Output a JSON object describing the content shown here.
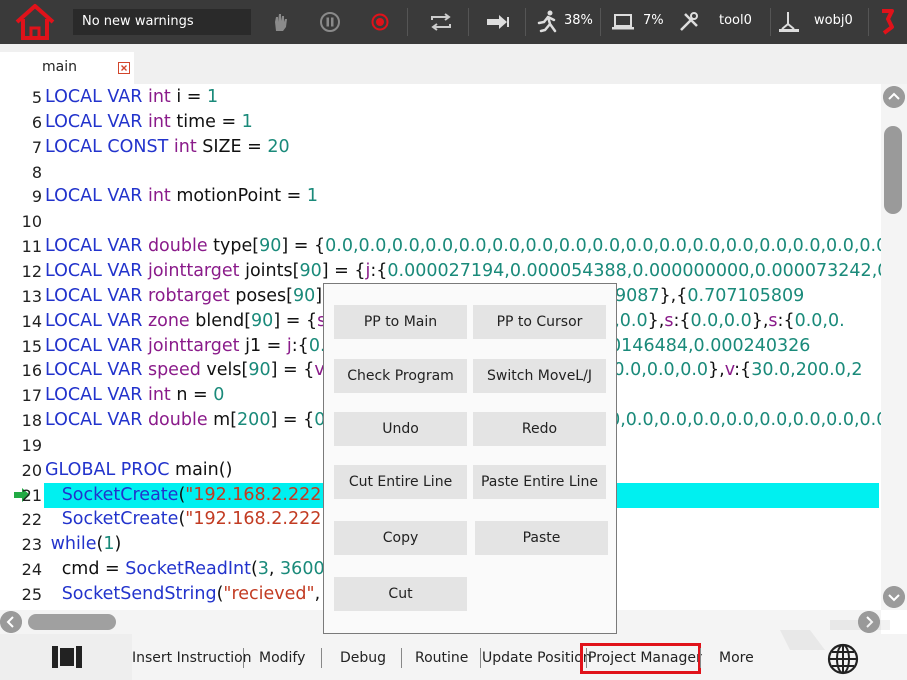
{
  "topbar": {
    "warnings_text": "No new warnings",
    "speed_value": "38%",
    "load_value": "7%",
    "tool_name": "tool0",
    "wobj_name": "wobj0",
    "icons": [
      "home-icon",
      "hand-icon",
      "pause-icon",
      "record-icon",
      "loop-icon",
      "step-forward-icon",
      "speed-icon",
      "laptop-icon",
      "tool-icon",
      "wobj-icon",
      "robot-arm-icon"
    ],
    "accent_color": "#e0121a"
  },
  "tabs": [
    {
      "label": "main"
    }
  ],
  "code_lines": [
    {
      "num": "5",
      "tokens": [
        [
          "LOCAL VAR ",
          "kw"
        ],
        [
          "int",
          "ty"
        ],
        [
          " i = ",
          ""
        ],
        [
          "1",
          "nm"
        ]
      ]
    },
    {
      "num": "6",
      "tokens": [
        [
          "LOCAL VAR ",
          "kw"
        ],
        [
          "int",
          "ty"
        ],
        [
          " time = ",
          ""
        ],
        [
          "1",
          "nm"
        ]
      ]
    },
    {
      "num": "7",
      "tokens": [
        [
          "LOCAL CONST ",
          "kw"
        ],
        [
          "int",
          "ty"
        ],
        [
          " SIZE = ",
          ""
        ],
        [
          "20",
          "nm"
        ]
      ]
    },
    {
      "num": "8",
      "tokens": []
    },
    {
      "num": "9",
      "tokens": [
        [
          "LOCAL VAR ",
          "kw"
        ],
        [
          "int",
          "ty"
        ],
        [
          " motionPoint = ",
          ""
        ],
        [
          "1",
          "nm"
        ]
      ]
    },
    {
      "num": "10",
      "tokens": []
    },
    {
      "num": "11",
      "tokens": [
        [
          "LOCAL VAR ",
          "kw"
        ],
        [
          "double",
          "ty"
        ],
        [
          " type[",
          ""
        ],
        [
          "90",
          "nm"
        ],
        [
          "] = {",
          ""
        ],
        [
          "0.0,0.0,0.0,0.0,0.0,0.0,0.0,0.0,0.0,0.0,0.0,0.0,0.0,0.0,0.0,0.0,0.0,0.0,0.0",
          "nm"
        ]
      ]
    },
    {
      "num": "12",
      "tokens": [
        [
          "LOCAL VAR ",
          "kw"
        ],
        [
          "jointtarget",
          "ty"
        ],
        [
          " joints[",
          ""
        ],
        [
          "90",
          "nm"
        ],
        [
          "] = {",
          ""
        ],
        [
          "j",
          "ty"
        ],
        [
          ":{",
          ""
        ],
        [
          "0.000027194,0.000054388,0.000000000,0.000073242,0.0001",
          "nm"
        ]
      ]
    },
    {
      "num": "13",
      "tokens": [
        [
          "LOCAL VAR ",
          "kw"
        ],
        [
          "robtarget",
          "ty"
        ],
        [
          " poses[",
          ""
        ],
        [
          "90",
          "nm"
        ],
        [
          "] = ",
          ""
        ],
        [
          "                              ",
          ""
        ],
        [
          ",854.999359087",
          "nm"
        ],
        [
          "},{",
          ""
        ],
        [
          "0.707105809",
          "nm"
        ]
      ]
    },
    {
      "num": "14",
      "tokens": [
        [
          "LOCAL VAR ",
          "kw"
        ],
        [
          "zone",
          "ty"
        ],
        [
          " blend[",
          ""
        ],
        [
          "90",
          "nm"
        ],
        [
          "] = {",
          ""
        ],
        [
          "s",
          "ty"
        ],
        [
          ":{",
          ""
        ],
        [
          "                               ",
          ""
        ],
        [
          "0.0",
          "nm"
        ],
        [
          "},",
          ""
        ],
        [
          "s",
          "ty"
        ],
        [
          ":{",
          ""
        ],
        [
          "0.0,0.0",
          "nm"
        ],
        [
          "},",
          ""
        ],
        [
          "s",
          "ty"
        ],
        [
          ":{",
          ""
        ],
        [
          "0.0,0.0",
          "nm"
        ],
        [
          "},",
          ""
        ],
        [
          "s",
          "ty"
        ],
        [
          ":{",
          ""
        ],
        [
          "0.0,0.",
          "nm"
        ]
      ]
    },
    {
      "num": "15",
      "tokens": [
        [
          "LOCAL VAR ",
          "kw"
        ],
        [
          "jointtarget",
          "ty"
        ],
        [
          " j1 = ",
          ""
        ],
        [
          "j",
          "ty"
        ],
        [
          ":{",
          ""
        ],
        [
          "0.00",
          "nm"
        ],
        [
          "                                ",
          ""
        ],
        [
          "969,-0.000146484,0.000240326",
          "nm"
        ]
      ]
    },
    {
      "num": "16",
      "tokens": [
        [
          "LOCAL VAR ",
          "kw"
        ],
        [
          "speed",
          "ty"
        ],
        [
          " vels[",
          ""
        ],
        [
          "90",
          "nm"
        ],
        [
          "] = {",
          ""
        ],
        [
          "v",
          "ty"
        ],
        [
          ":{",
          ""
        ],
        [
          "3",
          "nm"
        ],
        [
          "                                     ",
          ""
        ],
        [
          "0.0,200.0,0.0,0.0",
          "nm"
        ],
        [
          "},",
          ""
        ],
        [
          "v",
          "ty"
        ],
        [
          ":{",
          ""
        ],
        [
          "30.0,200.0,2",
          "nm"
        ]
      ]
    },
    {
      "num": "17",
      "tokens": [
        [
          "LOCAL VAR ",
          "kw"
        ],
        [
          "int",
          "ty"
        ],
        [
          " n = ",
          ""
        ],
        [
          "0",
          "nm"
        ]
      ]
    },
    {
      "num": "18",
      "tokens": [
        [
          "LOCAL VAR ",
          "kw"
        ],
        [
          "double",
          "ty"
        ],
        [
          " m[",
          ""
        ],
        [
          "200",
          "nm"
        ],
        [
          "] = {",
          ""
        ],
        [
          "0.0",
          "nm"
        ],
        [
          "                                    ",
          ""
        ],
        [
          "0,0.0,0.0,0.0,0.0,0.0,0.0,0.0,0.0,0.0,0.0",
          "nm"
        ]
      ]
    },
    {
      "num": "19",
      "tokens": []
    },
    {
      "num": "20",
      "tokens": [
        [
          "GLOBAL PROC ",
          "kw"
        ],
        [
          "main()",
          ""
        ]
      ]
    },
    {
      "num": "21",
      "tokens": [
        [
          "   ",
          ""
        ],
        [
          "SocketCreate",
          "fn"
        ],
        [
          "(",
          ""
        ],
        [
          "\"192.168.2.222\"",
          "st"
        ],
        [
          ",",
          ""
        ]
      ],
      "highlight": true,
      "pointer": true
    },
    {
      "num": "22",
      "tokens": [
        [
          "   ",
          ""
        ],
        [
          "SocketCreate",
          "fn"
        ],
        [
          "(",
          ""
        ],
        [
          "\"192.168.2.222\"",
          "st"
        ],
        [
          ",",
          ""
        ]
      ]
    },
    {
      "num": "23",
      "tokens": [
        [
          " ",
          ""
        ],
        [
          "while",
          "kw"
        ],
        [
          "(",
          ""
        ],
        [
          "1",
          "nm"
        ],
        [
          ")",
          ""
        ]
      ]
    },
    {
      "num": "24",
      "tokens": [
        [
          "   cmd = ",
          ""
        ],
        [
          "SocketReadInt",
          "fn"
        ],
        [
          "(",
          ""
        ],
        [
          "3",
          "nm"
        ],
        [
          ", ",
          ""
        ],
        [
          "36000",
          "nm"
        ]
      ]
    },
    {
      "num": "25",
      "tokens": [
        [
          "   ",
          ""
        ],
        [
          "SocketSendString",
          "fn"
        ],
        [
          "(",
          ""
        ],
        [
          "\"recieved\"",
          "st"
        ],
        [
          ", r",
          ""
        ]
      ]
    }
  ],
  "popup": {
    "buttons": [
      "PP to Main",
      "PP to Cursor",
      "Check Program",
      "Switch MoveL/J",
      "Undo",
      "Redo",
      "Cut Entire Line",
      "Paste Entire Line",
      "Copy",
      "Paste",
      "Cut"
    ]
  },
  "bottombar": {
    "items": [
      "Insert Instruction",
      "Modify",
      "Debug",
      "Routine",
      "Update Position",
      "Project Manager",
      "More"
    ],
    "highlighted": "Project Manager",
    "highlight_color": "#e0121a"
  }
}
